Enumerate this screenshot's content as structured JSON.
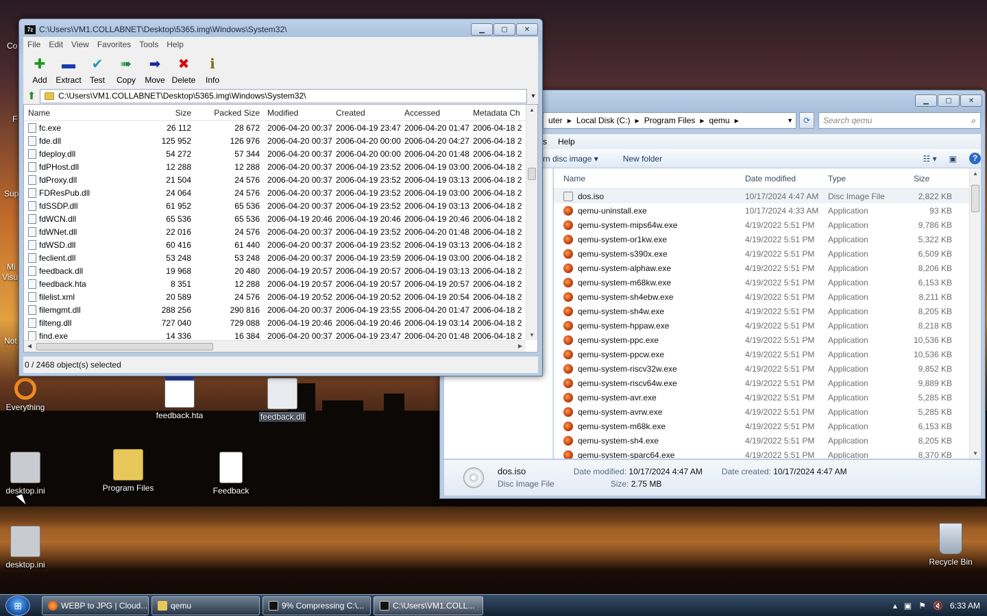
{
  "desktop": {
    "icons": [
      {
        "label": "Everything"
      },
      {
        "label": "feedback.hta"
      },
      {
        "label": "feedback.dll"
      },
      {
        "label": "desktop.ini"
      },
      {
        "label": "Program Files"
      },
      {
        "label": "Feedback"
      },
      {
        "label": "desktop.ini"
      },
      {
        "label": "Recycle Bin"
      }
    ],
    "partial_labels": [
      "Co",
      "F",
      "Sup",
      "Mi",
      "Visu",
      "Not"
    ]
  },
  "zip_window": {
    "title": "C:\\Users\\VM1.COLLABNET\\Desktop\\5365.img\\Windows\\System32\\",
    "menu": [
      "File",
      "Edit",
      "View",
      "Favorites",
      "Tools",
      "Help"
    ],
    "toolbar": [
      {
        "label": "Add",
        "icon": "plus-icon",
        "color": "#1a9a1a"
      },
      {
        "label": "Extract",
        "icon": "minus-icon",
        "color": "#1a3ab0"
      },
      {
        "label": "Test",
        "icon": "check-icon",
        "color": "#1a9ab0"
      },
      {
        "label": "Copy",
        "icon": "double-arrow-icon",
        "color": "#1a8a3a"
      },
      {
        "label": "Move",
        "icon": "arrow-right-icon",
        "color": "#1a2aa0"
      },
      {
        "label": "Delete",
        "icon": "x-icon",
        "color": "#d01010"
      },
      {
        "label": "Info",
        "icon": "info-icon",
        "color": "#806a10"
      }
    ],
    "address": "C:\\Users\\VM1.COLLABNET\\Desktop\\5365.img\\Windows\\System32\\",
    "columns": [
      "Name",
      "Size",
      "Packed Size",
      "Modified",
      "Created",
      "Accessed",
      "Metadata Ch"
    ],
    "rows": [
      [
        "fc.exe",
        "26 112",
        "28 672",
        "2006-04-20 00:37",
        "2006-04-19 23:47",
        "2006-04-20 01:47",
        "2006-04-18 2"
      ],
      [
        "fde.dll",
        "125 952",
        "126 976",
        "2006-04-20 00:37",
        "2006-04-20 00:00",
        "2006-04-20 04:27",
        "2006-04-18 2"
      ],
      [
        "fdeploy.dll",
        "54 272",
        "57 344",
        "2006-04-20 00:37",
        "2006-04-20 00:00",
        "2006-04-20 01:48",
        "2006-04-18 2"
      ],
      [
        "fdPHost.dll",
        "12 288",
        "12 288",
        "2006-04-20 00:37",
        "2006-04-19 23:52",
        "2006-04-19 03:00",
        "2006-04-18 2"
      ],
      [
        "fdProxy.dll",
        "21 504",
        "24 576",
        "2006-04-20 00:37",
        "2006-04-19 23:52",
        "2006-04-19 03:13",
        "2006-04-18 2"
      ],
      [
        "FDResPub.dll",
        "24 064",
        "24 576",
        "2006-04-20 00:37",
        "2006-04-19 23:52",
        "2006-04-19 03:00",
        "2006-04-18 2"
      ],
      [
        "fdSSDP.dll",
        "61 952",
        "65 536",
        "2006-04-20 00:37",
        "2006-04-19 23:52",
        "2006-04-19 03:13",
        "2006-04-18 2"
      ],
      [
        "fdWCN.dll",
        "65 536",
        "65 536",
        "2006-04-19 20:46",
        "2006-04-19 20:46",
        "2006-04-19 20:46",
        "2006-04-18 2"
      ],
      [
        "fdWNet.dll",
        "22 016",
        "24 576",
        "2006-04-20 00:37",
        "2006-04-19 23:52",
        "2006-04-20 01:48",
        "2006-04-18 2"
      ],
      [
        "fdWSD.dll",
        "60 416",
        "61 440",
        "2006-04-20 00:37",
        "2006-04-19 23:52",
        "2006-04-19 03:13",
        "2006-04-18 2"
      ],
      [
        "feclient.dll",
        "53 248",
        "53 248",
        "2006-04-20 00:37",
        "2006-04-19 23:59",
        "2006-04-19 03:00",
        "2006-04-18 2"
      ],
      [
        "feedback.dll",
        "19 968",
        "20 480",
        "2006-04-19 20:57",
        "2006-04-19 20:57",
        "2006-04-19 03:13",
        "2006-04-18 2"
      ],
      [
        "feedback.hta",
        "8 351",
        "12 288",
        "2006-04-19 20:57",
        "2006-04-19 20:57",
        "2006-04-19 20:57",
        "2006-04-18 2"
      ],
      [
        "filelist.xml",
        "20 589",
        "24 576",
        "2006-04-19 20:52",
        "2006-04-19 20:52",
        "2006-04-19 20:54",
        "2006-04-18 2"
      ],
      [
        "filemgmt.dll",
        "288 256",
        "290 816",
        "2006-04-20 00:37",
        "2006-04-19 23:55",
        "2006-04-20 01:47",
        "2006-04-18 2"
      ],
      [
        "filteng.dll",
        "727 040",
        "729 088",
        "2006-04-19 20:46",
        "2006-04-19 20:46",
        "2006-04-19 03:14",
        "2006-04-18 2"
      ],
      [
        "find.exe",
        "14 336",
        "16 384",
        "2006-04-20 00:37",
        "2006-04-19 23:47",
        "2006-04-20 01:48",
        "2006-04-18 2"
      ]
    ],
    "status": "0 / 2468 object(s) selected"
  },
  "explorer_window": {
    "breadcrumb": [
      "uter",
      "Local Disk (C:)",
      "Program Files",
      "qemu"
    ],
    "search_placeholder": "Search qemu",
    "menu": [
      "s",
      "Help"
    ],
    "commands": [
      "rn disc image",
      "New folder"
    ],
    "columns": [
      "Name",
      "Date modified",
      "Type",
      "Size"
    ],
    "rows": [
      [
        "dos.iso",
        "10/17/2024 4:47 AM",
        "Disc Image File",
        "2,822 KB"
      ],
      [
        "qemu-uninstall.exe",
        "10/17/2024 4:33 AM",
        "Application",
        "93 KB"
      ],
      [
        "qemu-system-mips64w.exe",
        "4/19/2022 5:51 PM",
        "Application",
        "9,786 KB"
      ],
      [
        "qemu-system-or1kw.exe",
        "4/19/2022 5:51 PM",
        "Application",
        "5,322 KB"
      ],
      [
        "qemu-system-s390x.exe",
        "4/19/2022 5:51 PM",
        "Application",
        "6,509 KB"
      ],
      [
        "qemu-system-alphaw.exe",
        "4/19/2022 5:51 PM",
        "Application",
        "8,206 KB"
      ],
      [
        "qemu-system-m68kw.exe",
        "4/19/2022 5:51 PM",
        "Application",
        "6,153 KB"
      ],
      [
        "qemu-system-sh4ebw.exe",
        "4/19/2022 5:51 PM",
        "Application",
        "8,211 KB"
      ],
      [
        "qemu-system-sh4w.exe",
        "4/19/2022 5:51 PM",
        "Application",
        "8,205 KB"
      ],
      [
        "qemu-system-hppaw.exe",
        "4/19/2022 5:51 PM",
        "Application",
        "8,218 KB"
      ],
      [
        "qemu-system-ppc.exe",
        "4/19/2022 5:51 PM",
        "Application",
        "10,536 KB"
      ],
      [
        "qemu-system-ppcw.exe",
        "4/19/2022 5:51 PM",
        "Application",
        "10,536 KB"
      ],
      [
        "qemu-system-riscv32w.exe",
        "4/19/2022 5:51 PM",
        "Application",
        "9,852 KB"
      ],
      [
        "qemu-system-riscv64w.exe",
        "4/19/2022 5:51 PM",
        "Application",
        "9,889 KB"
      ],
      [
        "qemu-system-avr.exe",
        "4/19/2022 5:51 PM",
        "Application",
        "5,285 KB"
      ],
      [
        "qemu-system-avrw.exe",
        "4/19/2022 5:51 PM",
        "Application",
        "5,285 KB"
      ],
      [
        "qemu-system-m68k.exe",
        "4/19/2022 5:51 PM",
        "Application",
        "6,153 KB"
      ],
      [
        "qemu-system-sh4.exe",
        "4/19/2022 5:51 PM",
        "Application",
        "8,205 KB"
      ],
      [
        "qemu-system-sparc64.exe",
        "4/19/2022 5:51 PM",
        "Application",
        "8,370 KB"
      ]
    ],
    "details": {
      "name": "dos.iso",
      "type": "Disc Image File",
      "date_modified_label": "Date modified:",
      "date_modified": "10/17/2024 4:47 AM",
      "size_label": "Size:",
      "size": "2.75 MB",
      "date_created_label": "Date created:",
      "date_created": "10/17/2024 4:47 AM"
    }
  },
  "taskbar": {
    "tasks": [
      {
        "label": "WEBP to JPG | Cloud..."
      },
      {
        "label": "qemu"
      },
      {
        "label": "9% Compressing C:\\..."
      },
      {
        "label": "C:\\Users\\VM1.COLL..."
      }
    ],
    "clock": "6:33 AM"
  }
}
